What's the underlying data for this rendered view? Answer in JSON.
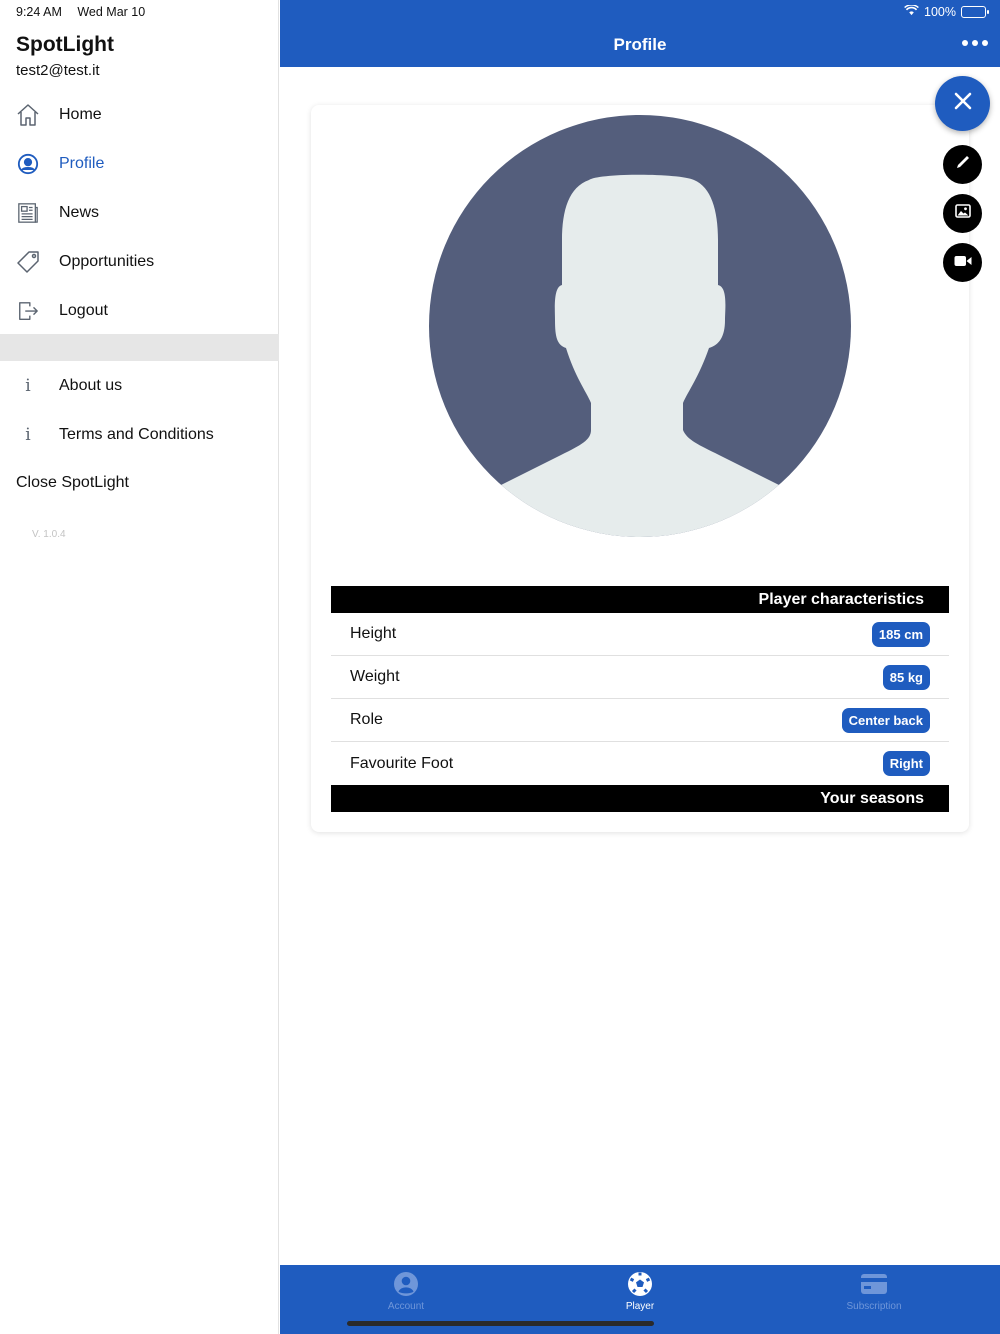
{
  "status": {
    "time": "9:24 AM",
    "date": "Wed Mar 10",
    "battery": "100%"
  },
  "sidebar": {
    "app_name": "SpotLight",
    "email": "test2@test.it",
    "items": [
      {
        "label": "Home",
        "icon": "home-icon"
      },
      {
        "label": "Profile",
        "icon": "user-circle-icon"
      },
      {
        "label": "News",
        "icon": "newspaper-icon"
      },
      {
        "label": "Opportunities",
        "icon": "tag-icon"
      },
      {
        "label": "Logout",
        "icon": "logout-icon"
      }
    ],
    "secondary_items": [
      {
        "label": "About us",
        "icon": "info-icon"
      },
      {
        "label": "Terms and Conditions",
        "icon": "info-icon"
      }
    ],
    "close_label": "Close SpotLight",
    "version": "V. 1.0.4"
  },
  "header": {
    "title": "Profile"
  },
  "characteristics": {
    "title": "Player characteristics",
    "rows": [
      {
        "label": "Height",
        "value": "185 cm"
      },
      {
        "label": "Weight",
        "value": "85 kg"
      },
      {
        "label": "Role",
        "value": "Center back"
      },
      {
        "label": "Favourite Foot",
        "value": "Right"
      }
    ],
    "seasons_title": "Your seasons"
  },
  "tabs": [
    {
      "label": "Account",
      "icon": "account-icon"
    },
    {
      "label": "Player",
      "icon": "soccer-ball-icon"
    },
    {
      "label": "Subscription",
      "icon": "credit-card-icon"
    }
  ],
  "colors": {
    "primary": "#1f5cbf",
    "avatar_bg": "#545e7c",
    "avatar_fg": "#e6ecec"
  }
}
